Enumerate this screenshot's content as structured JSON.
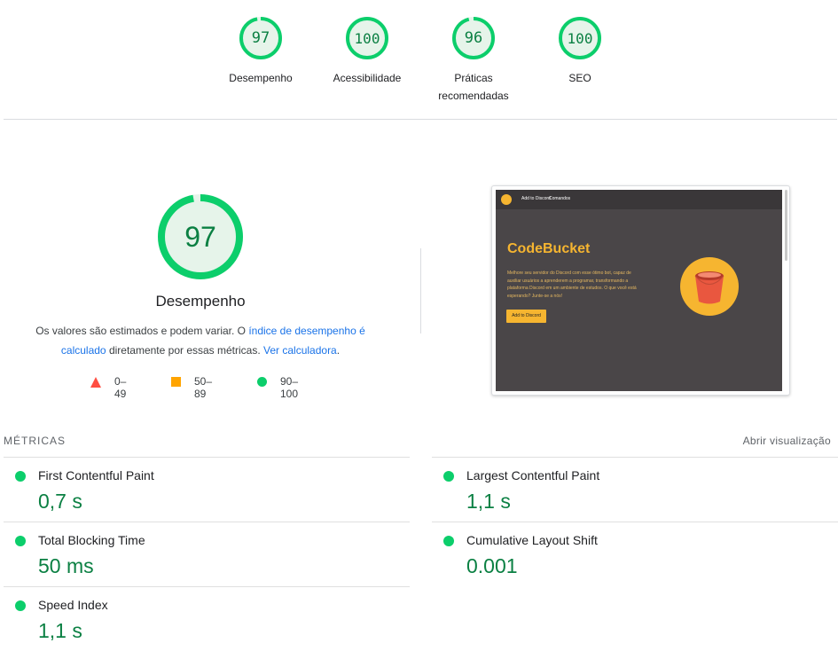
{
  "categories": [
    {
      "score": "97",
      "label": "Desempenho",
      "fraction": 0.97
    },
    {
      "score": "100",
      "label": "Acessibilidade",
      "fraction": 1.0
    },
    {
      "score": "96",
      "label": "Práticas recomendadas",
      "fraction": 0.96
    },
    {
      "score": "100",
      "label": "SEO",
      "fraction": 1.0
    }
  ],
  "main_gauge": {
    "score": "97",
    "label": "Desempenho",
    "fraction": 0.97
  },
  "description": {
    "text1": "Os valores são estimados e podem variar. O ",
    "link1": "índice de desempenho é calculado",
    "text2": " diretamente por essas métricas. ",
    "link2": "Ver calculadora",
    "text3": "."
  },
  "legend": [
    {
      "range": "0–49",
      "shape": "triangle",
      "color": "#ff4e42"
    },
    {
      "range": "50–89",
      "shape": "square",
      "color": "#ffa400"
    },
    {
      "range": "90–100",
      "shape": "circle",
      "color": "#0cce6b"
    }
  ],
  "screenshot": {
    "nav": [
      "Add to Discord",
      "Comandos"
    ],
    "title": "CodeBucket",
    "text": "Melhore seu servidor do Discord com esse ótimo bot, capaz de auxiliar usuários a aprenderem a programar, transformando a plataforma Discord em um ambiente de estudos. O que você está esperando? Junte-se a nós!",
    "button": "Add to Discord"
  },
  "metrics_section": {
    "title": "MÉTRICAS",
    "open_view": "Abrir visualização"
  },
  "metrics": [
    {
      "name": "First Contentful Paint",
      "value": "0,7 s"
    },
    {
      "name": "Largest Contentful Paint",
      "value": "1,1 s"
    },
    {
      "name": "Total Blocking Time",
      "value": "50 ms"
    },
    {
      "name": "Cumulative Layout Shift",
      "value": "0.001"
    },
    {
      "name": "Speed Index",
      "value": "1,1 s"
    }
  ],
  "colors": {
    "pass": "#0cce6b",
    "pass_text": "#0b8043",
    "pass_bg": "#e6f4ea"
  }
}
